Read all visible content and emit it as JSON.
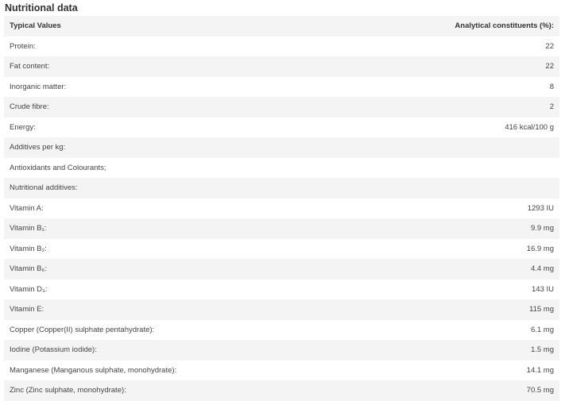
{
  "title": "Nutritional data",
  "header": {
    "col1": "Typical Values",
    "col2": "Analytical constituents (%):"
  },
  "rows": [
    {
      "label": "Protein:",
      "value": "22"
    },
    {
      "label": "Fat content:",
      "value": "22"
    },
    {
      "label": "Inorganic matter:",
      "value": "8"
    },
    {
      "label": "Crude fibre:",
      "value": "2"
    },
    {
      "label": "Energy:",
      "value": "416 kcal/100 g"
    },
    {
      "label": "Additives per kg:",
      "value": ""
    },
    {
      "label": "Antioxidants and Colourants;",
      "value": ""
    },
    {
      "label": "Nutritional additives:",
      "value": ""
    },
    {
      "label": "Vitamin A:",
      "value": "1293 IU"
    },
    {
      "label": "Vitamin B₁:",
      "value": "9.9 mg"
    },
    {
      "label": "Vitamin B₂:",
      "value": "16.9 mg"
    },
    {
      "label": "Vitamin B₆:",
      "value": "4.4 mg"
    },
    {
      "label": "Vitamin D₃:",
      "value": "143 IU"
    },
    {
      "label": "Vitamin E:",
      "value": "115 mg"
    },
    {
      "label": "Copper (Copper(II) sulphate pentahydrate):",
      "value": "6.1 mg"
    },
    {
      "label": "Iodine (Potassium iodide):",
      "value": "1.5 mg"
    },
    {
      "label": "Manganese (Manganous sulphate, monohydrate):",
      "value": "14.1 mg"
    },
    {
      "label": "Zinc (Zinc sulphate, monohydrate):",
      "value": "70.5 mg"
    }
  ]
}
